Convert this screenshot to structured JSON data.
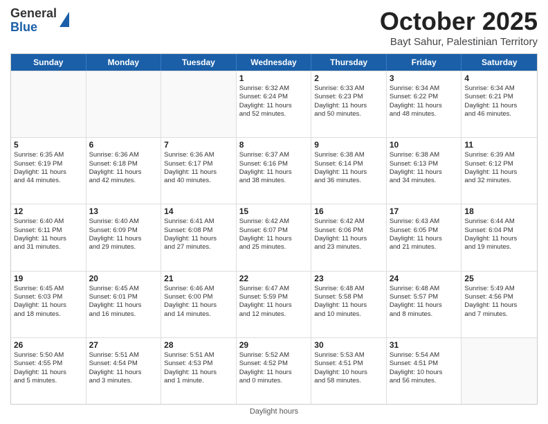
{
  "logo": {
    "general": "General",
    "blue": "Blue"
  },
  "title": "October 2025",
  "location": "Bayt Sahur, Palestinian Territory",
  "days": [
    "Sunday",
    "Monday",
    "Tuesday",
    "Wednesday",
    "Thursday",
    "Friday",
    "Saturday"
  ],
  "footer": "Daylight hours",
  "weeks": [
    [
      {
        "day": "",
        "lines": []
      },
      {
        "day": "",
        "lines": []
      },
      {
        "day": "",
        "lines": []
      },
      {
        "day": "1",
        "lines": [
          "Sunrise: 6:32 AM",
          "Sunset: 6:24 PM",
          "Daylight: 11 hours",
          "and 52 minutes."
        ]
      },
      {
        "day": "2",
        "lines": [
          "Sunrise: 6:33 AM",
          "Sunset: 6:23 PM",
          "Daylight: 11 hours",
          "and 50 minutes."
        ]
      },
      {
        "day": "3",
        "lines": [
          "Sunrise: 6:34 AM",
          "Sunset: 6:22 PM",
          "Daylight: 11 hours",
          "and 48 minutes."
        ]
      },
      {
        "day": "4",
        "lines": [
          "Sunrise: 6:34 AM",
          "Sunset: 6:21 PM",
          "Daylight: 11 hours",
          "and 46 minutes."
        ]
      }
    ],
    [
      {
        "day": "5",
        "lines": [
          "Sunrise: 6:35 AM",
          "Sunset: 6:19 PM",
          "Daylight: 11 hours",
          "and 44 minutes."
        ]
      },
      {
        "day": "6",
        "lines": [
          "Sunrise: 6:36 AM",
          "Sunset: 6:18 PM",
          "Daylight: 11 hours",
          "and 42 minutes."
        ]
      },
      {
        "day": "7",
        "lines": [
          "Sunrise: 6:36 AM",
          "Sunset: 6:17 PM",
          "Daylight: 11 hours",
          "and 40 minutes."
        ]
      },
      {
        "day": "8",
        "lines": [
          "Sunrise: 6:37 AM",
          "Sunset: 6:16 PM",
          "Daylight: 11 hours",
          "and 38 minutes."
        ]
      },
      {
        "day": "9",
        "lines": [
          "Sunrise: 6:38 AM",
          "Sunset: 6:14 PM",
          "Daylight: 11 hours",
          "and 36 minutes."
        ]
      },
      {
        "day": "10",
        "lines": [
          "Sunrise: 6:38 AM",
          "Sunset: 6:13 PM",
          "Daylight: 11 hours",
          "and 34 minutes."
        ]
      },
      {
        "day": "11",
        "lines": [
          "Sunrise: 6:39 AM",
          "Sunset: 6:12 PM",
          "Daylight: 11 hours",
          "and 32 minutes."
        ]
      }
    ],
    [
      {
        "day": "12",
        "lines": [
          "Sunrise: 6:40 AM",
          "Sunset: 6:11 PM",
          "Daylight: 11 hours",
          "and 31 minutes."
        ]
      },
      {
        "day": "13",
        "lines": [
          "Sunrise: 6:40 AM",
          "Sunset: 6:09 PM",
          "Daylight: 11 hours",
          "and 29 minutes."
        ]
      },
      {
        "day": "14",
        "lines": [
          "Sunrise: 6:41 AM",
          "Sunset: 6:08 PM",
          "Daylight: 11 hours",
          "and 27 minutes."
        ]
      },
      {
        "day": "15",
        "lines": [
          "Sunrise: 6:42 AM",
          "Sunset: 6:07 PM",
          "Daylight: 11 hours",
          "and 25 minutes."
        ]
      },
      {
        "day": "16",
        "lines": [
          "Sunrise: 6:42 AM",
          "Sunset: 6:06 PM",
          "Daylight: 11 hours",
          "and 23 minutes."
        ]
      },
      {
        "day": "17",
        "lines": [
          "Sunrise: 6:43 AM",
          "Sunset: 6:05 PM",
          "Daylight: 11 hours",
          "and 21 minutes."
        ]
      },
      {
        "day": "18",
        "lines": [
          "Sunrise: 6:44 AM",
          "Sunset: 6:04 PM",
          "Daylight: 11 hours",
          "and 19 minutes."
        ]
      }
    ],
    [
      {
        "day": "19",
        "lines": [
          "Sunrise: 6:45 AM",
          "Sunset: 6:03 PM",
          "Daylight: 11 hours",
          "and 18 minutes."
        ]
      },
      {
        "day": "20",
        "lines": [
          "Sunrise: 6:45 AM",
          "Sunset: 6:01 PM",
          "Daylight: 11 hours",
          "and 16 minutes."
        ]
      },
      {
        "day": "21",
        "lines": [
          "Sunrise: 6:46 AM",
          "Sunset: 6:00 PM",
          "Daylight: 11 hours",
          "and 14 minutes."
        ]
      },
      {
        "day": "22",
        "lines": [
          "Sunrise: 6:47 AM",
          "Sunset: 5:59 PM",
          "Daylight: 11 hours",
          "and 12 minutes."
        ]
      },
      {
        "day": "23",
        "lines": [
          "Sunrise: 6:48 AM",
          "Sunset: 5:58 PM",
          "Daylight: 11 hours",
          "and 10 minutes."
        ]
      },
      {
        "day": "24",
        "lines": [
          "Sunrise: 6:48 AM",
          "Sunset: 5:57 PM",
          "Daylight: 11 hours",
          "and 8 minutes."
        ]
      },
      {
        "day": "25",
        "lines": [
          "Sunrise: 5:49 AM",
          "Sunset: 4:56 PM",
          "Daylight: 11 hours",
          "and 7 minutes."
        ]
      }
    ],
    [
      {
        "day": "26",
        "lines": [
          "Sunrise: 5:50 AM",
          "Sunset: 4:55 PM",
          "Daylight: 11 hours",
          "and 5 minutes."
        ]
      },
      {
        "day": "27",
        "lines": [
          "Sunrise: 5:51 AM",
          "Sunset: 4:54 PM",
          "Daylight: 11 hours",
          "and 3 minutes."
        ]
      },
      {
        "day": "28",
        "lines": [
          "Sunrise: 5:51 AM",
          "Sunset: 4:53 PM",
          "Daylight: 11 hours",
          "and 1 minute."
        ]
      },
      {
        "day": "29",
        "lines": [
          "Sunrise: 5:52 AM",
          "Sunset: 4:52 PM",
          "Daylight: 11 hours",
          "and 0 minutes."
        ]
      },
      {
        "day": "30",
        "lines": [
          "Sunrise: 5:53 AM",
          "Sunset: 4:51 PM",
          "Daylight: 10 hours",
          "and 58 minutes."
        ]
      },
      {
        "day": "31",
        "lines": [
          "Sunrise: 5:54 AM",
          "Sunset: 4:51 PM",
          "Daylight: 10 hours",
          "and 56 minutes."
        ]
      },
      {
        "day": "",
        "lines": []
      }
    ]
  ]
}
